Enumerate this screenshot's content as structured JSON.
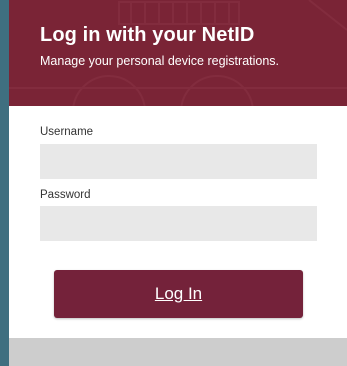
{
  "header": {
    "title": "Log in with your NetID",
    "subtitle": "Manage your personal device registrations."
  },
  "form": {
    "username_label": "Username",
    "username_value": "",
    "password_label": "Password",
    "password_value": "",
    "submit_label": "Log In"
  },
  "colors": {
    "brand": "#7a2436",
    "button": "#74223a",
    "input_bg": "#e8e8e8",
    "page_bg": "#3d6e7f",
    "footer": "#cdcdcd"
  }
}
